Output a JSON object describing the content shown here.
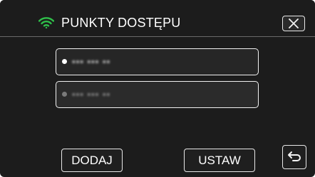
{
  "header": {
    "title": "PUNKTY DOSTĘPU",
    "wifi_icon": "wifi-icon",
    "close_icon": "close-icon"
  },
  "access_points": [
    {
      "name": "▪▪▪ ▪▪▪ ▪▪",
      "selected": true
    },
    {
      "name": "▪▪▪ ▪▪▪ ▪▪",
      "selected": false
    }
  ],
  "footer": {
    "add_label": "DODAJ",
    "set_label": "USTAW",
    "back_icon": "return-icon"
  },
  "colors": {
    "background": "#1c1c1c",
    "wifi_green": "#2fbf4a",
    "text": "#ffffff",
    "border": "#e8e8e8"
  }
}
